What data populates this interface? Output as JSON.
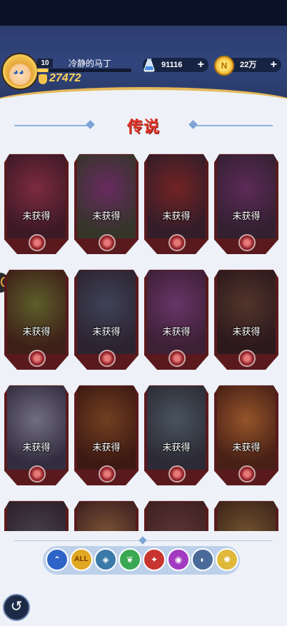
{
  "player": {
    "level": "10",
    "name": "冷静的马丁",
    "power": "27472",
    "xp_fraction": 0.12
  },
  "resources": {
    "potion_value": "91116",
    "coin_value": "22万",
    "coin_letter": "N",
    "plus": "+"
  },
  "section_title": "传说",
  "cards": [
    {
      "label": "未获得",
      "colors": [
        "#3a1f34",
        "#9a3b5a"
      ]
    },
    {
      "label": "未获得",
      "colors": [
        "#2f4a3a",
        "#7a3a8c"
      ]
    },
    {
      "label": "未获得",
      "colors": [
        "#2a2538",
        "#8a2f2f"
      ]
    },
    {
      "label": "未获得",
      "colors": [
        "#2a2a44",
        "#6a3a80"
      ]
    },
    {
      "label": "未获得",
      "colors": [
        "#3a2a1e",
        "#6a8a3a"
      ]
    },
    {
      "label": "未获得",
      "colors": [
        "#1f2f44",
        "#3d5f7f"
      ]
    },
    {
      "label": "未获得",
      "colors": [
        "#3a2a4a",
        "#7a4a9a"
      ]
    },
    {
      "label": "未获得",
      "colors": [
        "#1f1f24",
        "#5a4a3a"
      ]
    },
    {
      "label": "未获得",
      "colors": [
        "#2a3f5a",
        "#8aa0c0"
      ]
    },
    {
      "label": "未获得",
      "colors": [
        "#3a2016",
        "#8a5a2a"
      ]
    },
    {
      "label": "未获得",
      "colors": [
        "#203a4a",
        "#4a7a8a"
      ]
    },
    {
      "label": "未获得",
      "colors": [
        "#4a2a1a",
        "#c07a3a"
      ]
    },
    {
      "label": "",
      "colors": [
        "#1f2a3a",
        "#4a5a6a"
      ]
    },
    {
      "label": "",
      "colors": [
        "#3a2a2a",
        "#9a7a4a"
      ]
    },
    {
      "label": "",
      "colors": [
        "#3a2a2a",
        "#6a4a4a"
      ]
    },
    {
      "label": "",
      "colors": [
        "#3a3020",
        "#8a7a40"
      ]
    }
  ],
  "filters": [
    {
      "name": "collapse",
      "glyph": "⌃",
      "color": "#2e64c8"
    },
    {
      "name": "all",
      "glyph": "ALL",
      "color": "#e0a823"
    },
    {
      "name": "steel",
      "glyph": "◈",
      "color": "#3a7aa8"
    },
    {
      "name": "nature",
      "glyph": "❦",
      "color": "#3aa852"
    },
    {
      "name": "fire",
      "glyph": "✦",
      "color": "#c8352e"
    },
    {
      "name": "arcane",
      "glyph": "◉",
      "color": "#a23ac0"
    },
    {
      "name": "dark",
      "glyph": "◐",
      "color": "#4a6a9a"
    },
    {
      "name": "light",
      "glyph": "✺",
      "color": "#e0b83a"
    }
  ],
  "back_glyph": "↺"
}
